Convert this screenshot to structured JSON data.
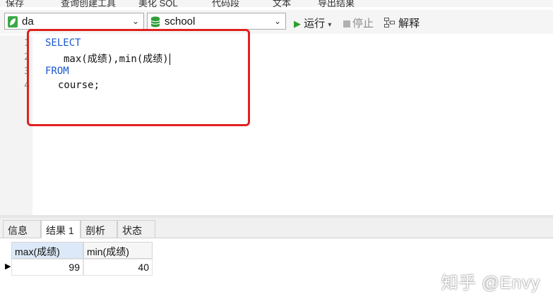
{
  "toolbar_top": {
    "items": [
      "保存",
      "查询创建工具",
      "美化 SQL",
      "代码段",
      "文本",
      "导出结果"
    ]
  },
  "selectors": {
    "connection": {
      "value": "da",
      "icon": "connection-leaf-icon",
      "color": "#3aa845"
    },
    "database": {
      "value": "school",
      "icon": "database-icon",
      "color": "#2e9e3a"
    }
  },
  "actions": {
    "run": "运行",
    "stop": "停止",
    "explain": "解释"
  },
  "editor": {
    "line_numbers": [
      "1",
      "2",
      "3",
      "4"
    ],
    "lines": [
      {
        "keyword": "SELECT",
        "text": ""
      },
      {
        "keyword": "",
        "text": "max(成绩),min(成绩)"
      },
      {
        "keyword": "FROM",
        "text": ""
      },
      {
        "keyword": "",
        "text": "course;"
      }
    ],
    "highlight_color": "#e0211f"
  },
  "result_tabs": [
    "信息",
    "结果 1",
    "剖析",
    "状态"
  ],
  "active_tab": "结果 1",
  "grid": {
    "columns": [
      "max(成绩)",
      "min(成绩)"
    ],
    "rows": [
      [
        "99",
        "40"
      ]
    ]
  },
  "watermark": "知乎 @Envy"
}
